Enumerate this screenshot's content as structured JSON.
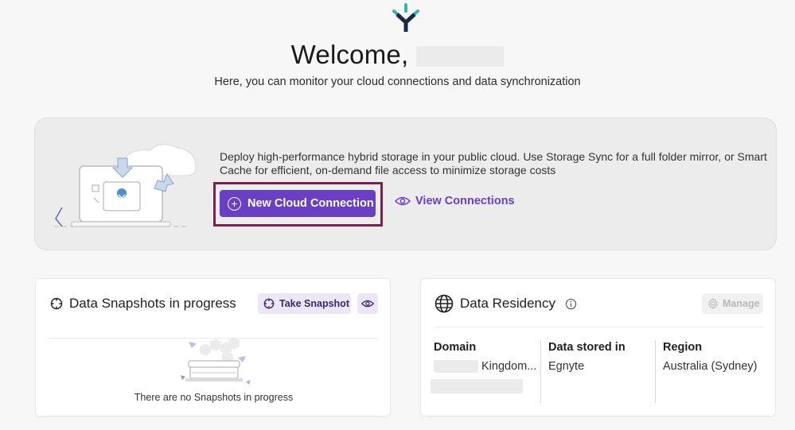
{
  "header": {
    "welcome": "Welcome,",
    "subtitle": "Here, you can monitor your cloud connections and data synchronization"
  },
  "banner": {
    "description": "Deploy high-performance hybrid storage in your public cloud. Use Storage Sync for a full folder mirror, or Smart Cache for efficient, on-demand file access to minimize storage costs",
    "primary_button": "New Cloud Connection",
    "secondary_link": "View Connections"
  },
  "snapshots": {
    "title": "Data Snapshots in progress",
    "take_snapshot": "Take Snapshot",
    "empty_text": "There are no Snapshots in progress"
  },
  "residency": {
    "title": "Data Residency",
    "manage": "Manage",
    "columns": [
      {
        "header": "Domain",
        "value": "Kingdom..."
      },
      {
        "header": "Data stored in",
        "value": "Egnyte"
      },
      {
        "header": "Region",
        "value": "Australia (Sydney)"
      }
    ]
  },
  "colors": {
    "accent": "#6a3fc3",
    "highlight_outline": "#7b1f4e",
    "logo_teal": "#3bb3a8",
    "logo_navy": "#1c2a4a"
  },
  "icons": [
    "egnyte-logo-icon",
    "plus-circle-icon",
    "eye-icon",
    "snapshot-icon",
    "globe-icon",
    "info-icon",
    "gear-icon"
  ]
}
